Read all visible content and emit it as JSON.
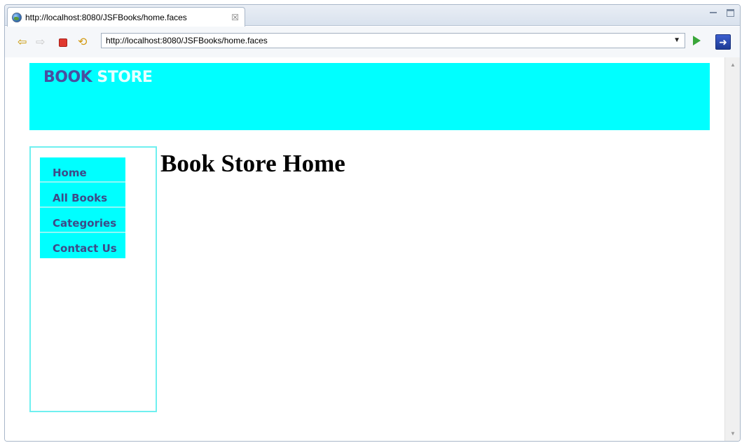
{
  "window": {
    "tab_title": "http://localhost:8080/JSFBooks/home.faces",
    "tab_close": "☒"
  },
  "toolbar": {
    "url": "http://localhost:8080/JSFBooks/home.faces"
  },
  "page": {
    "logo_part1": "BOOK",
    "logo_part2": "STORE",
    "title": "Book Store Home",
    "menu": [
      {
        "label": "Home"
      },
      {
        "label": "All Books"
      },
      {
        "label": "Categories"
      },
      {
        "label": "Contact Us"
      }
    ]
  },
  "colors": {
    "header_bg": "#00ffff",
    "logo_dark": "#4a4ea0",
    "logo_light": "#e6ffff",
    "menu_bg": "#00ffff",
    "menu_text": "#3e4a88",
    "sidebar_border": "#6ff0f0"
  },
  "icons": [
    "globe-icon",
    "close-tab-icon",
    "minimize-icon",
    "maximize-icon",
    "back-icon",
    "forward-icon",
    "stop-icon",
    "refresh-icon",
    "url-dropdown-icon",
    "go-icon",
    "external-browser-icon"
  ]
}
